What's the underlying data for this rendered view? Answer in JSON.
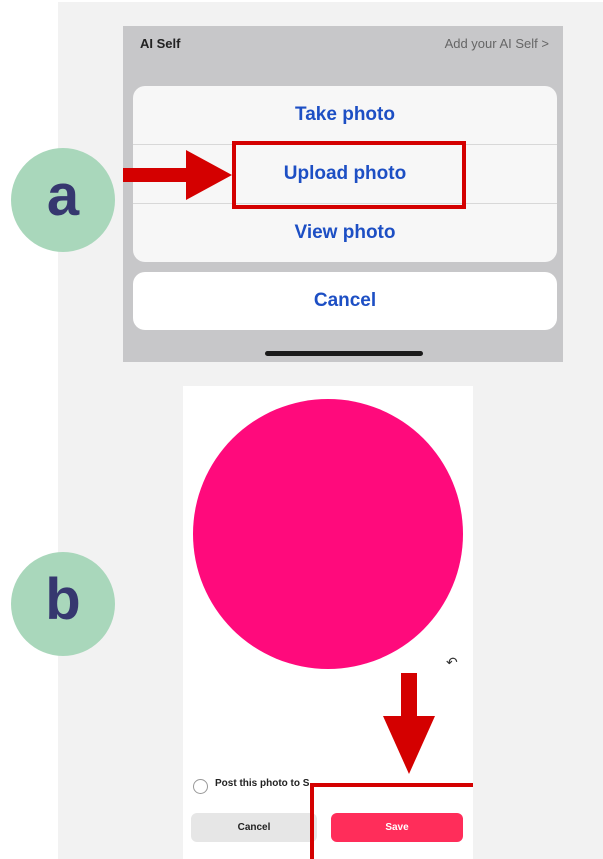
{
  "labels": {
    "a": "a",
    "b": "b"
  },
  "screenshot_a": {
    "header_left": "AI Self",
    "header_right": "Add your AI Self  >",
    "action_sheet": [
      "Take photo",
      "Upload photo",
      "View photo"
    ],
    "cancel": "Cancel"
  },
  "screenshot_b": {
    "undo_icon": "↶",
    "post_option_label": "Post this photo to S",
    "cancel_button": "Cancel",
    "save_button": "Save"
  },
  "colors": {
    "highlight": "#d40000",
    "badge": "#a9d7bb",
    "badge_text": "#36376f",
    "ios_blue": "#1d4fc4",
    "pink": "#ff0a7c",
    "save": "#ff2d5a"
  }
}
